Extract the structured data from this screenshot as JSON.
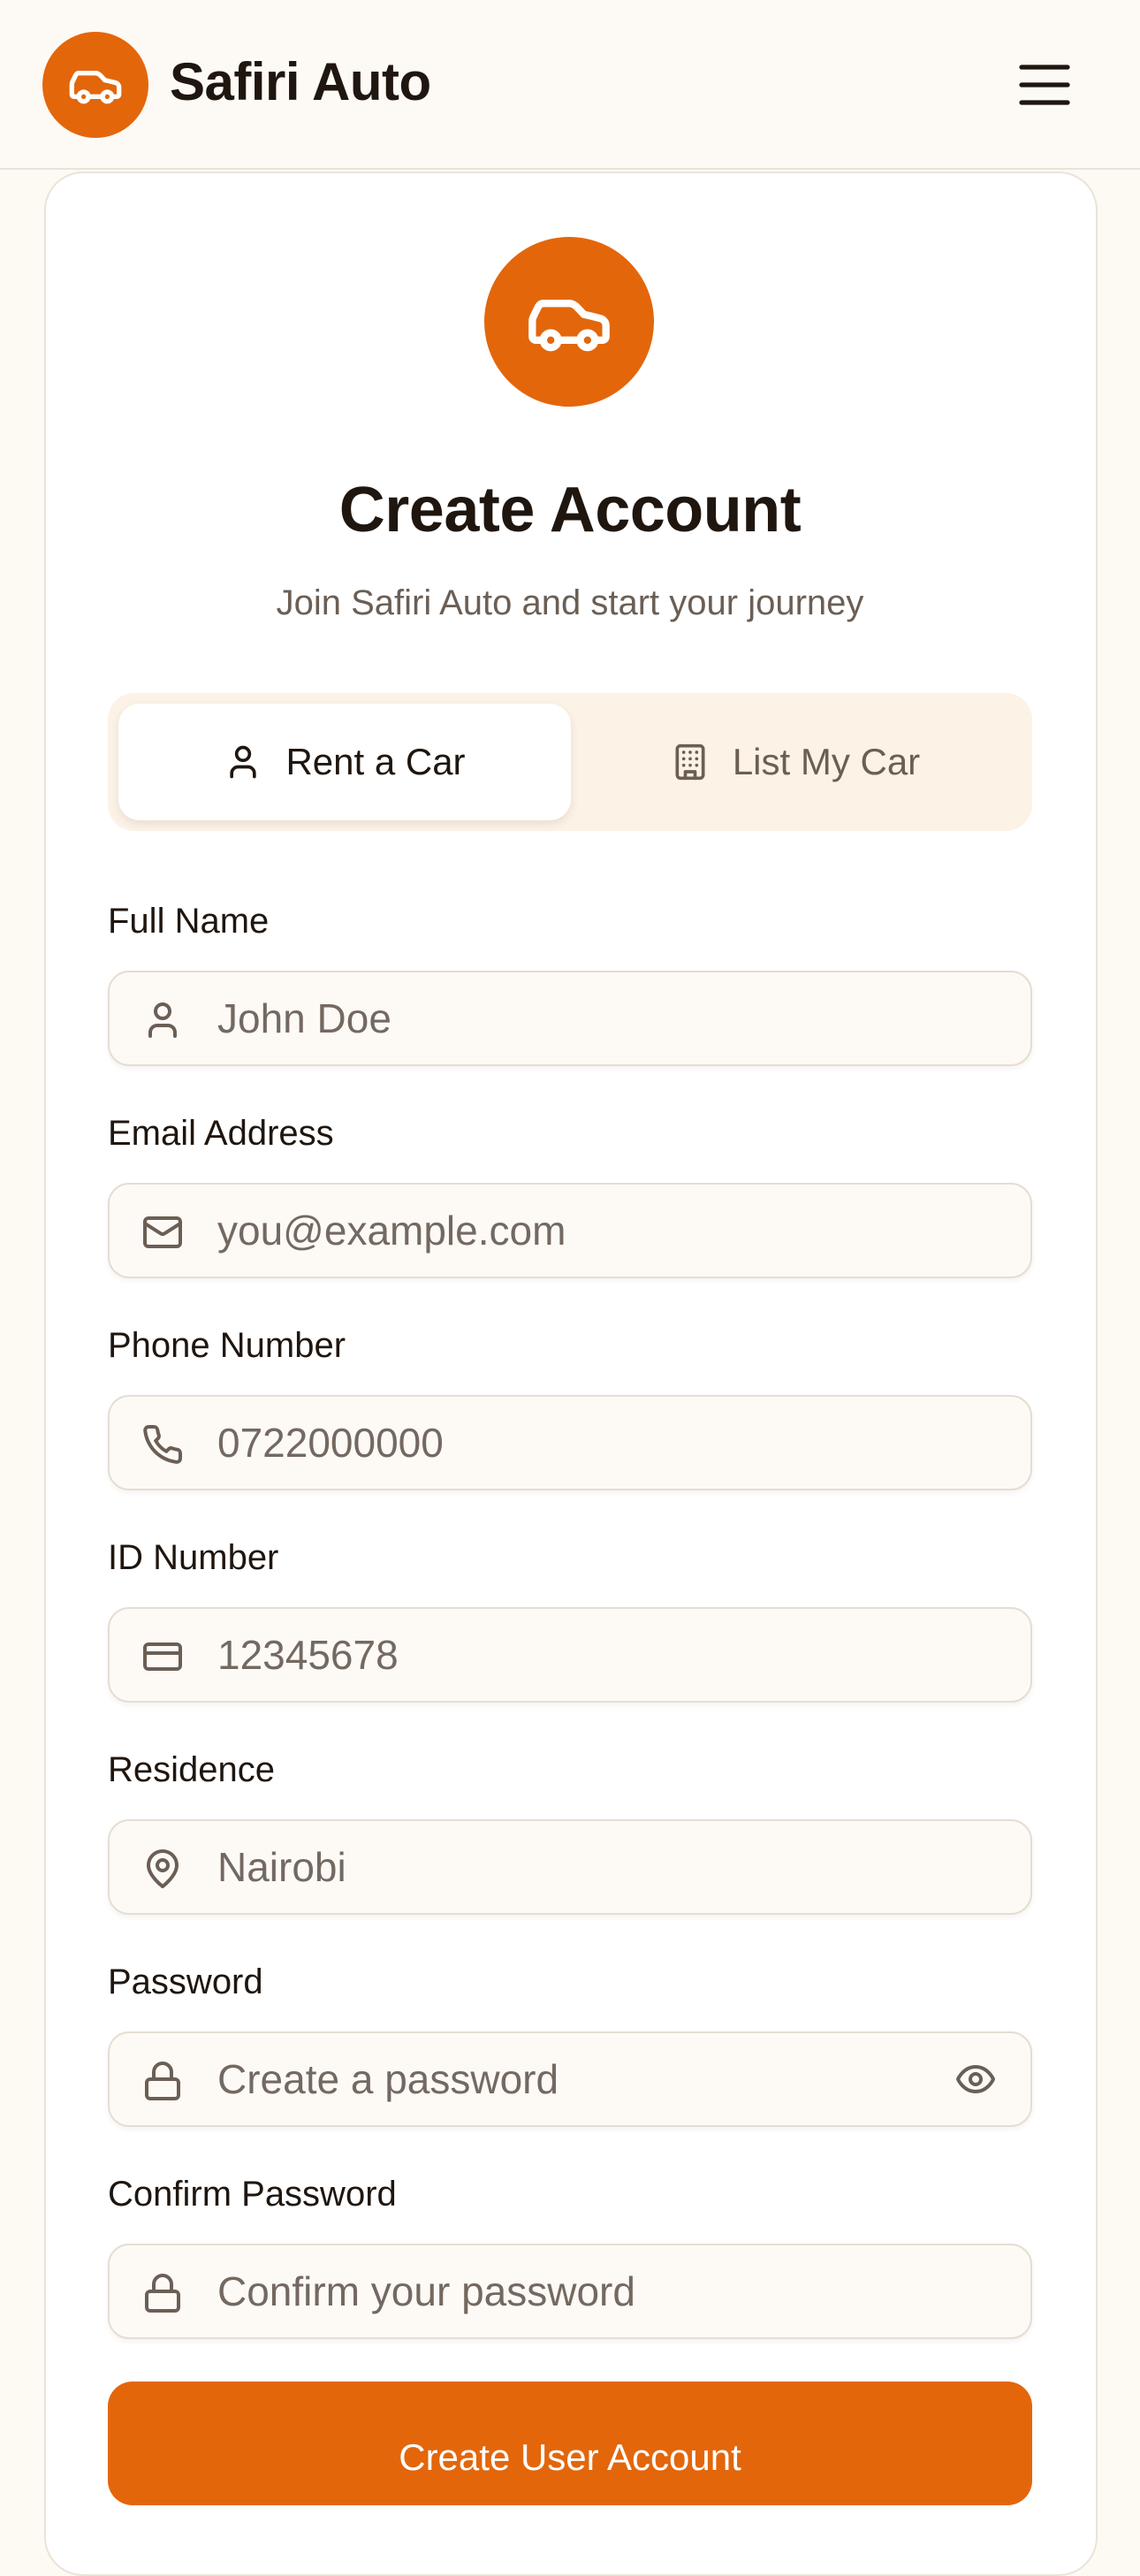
{
  "colors": {
    "accent": "#e3660b",
    "background": "#fdf9f3",
    "toggle_bg": "#fcf2e6",
    "text": "#1f160f",
    "muted": "#6b5f55"
  },
  "header": {
    "brand_name": "Safiri Auto",
    "logo_icon": "car-icon",
    "menu_icon": "hamburger-menu-icon"
  },
  "card": {
    "hero_icon": "car-icon",
    "title": "Create Account",
    "subtitle": "Join Safiri Auto and start your journey"
  },
  "account_type": {
    "options": [
      {
        "label": "Rent a Car",
        "icon": "user-icon",
        "selected": true
      },
      {
        "label": "List My Car",
        "icon": "building-icon",
        "selected": false
      }
    ]
  },
  "form": {
    "fields": [
      {
        "label": "Full Name",
        "placeholder": "John Doe",
        "value": "",
        "icon": "user-icon"
      },
      {
        "label": "Email Address",
        "placeholder": "you@example.com",
        "value": "",
        "icon": "mail-icon"
      },
      {
        "label": "Phone Number",
        "placeholder": "0722000000",
        "value": "",
        "icon": "phone-icon"
      },
      {
        "label": "ID Number",
        "placeholder": "12345678",
        "value": "",
        "icon": "id-card-icon"
      },
      {
        "label": "Residence",
        "placeholder": "Nairobi",
        "value": "",
        "icon": "map-pin-icon"
      },
      {
        "label": "Password",
        "placeholder": "Create a password",
        "value": "",
        "icon": "lock-icon",
        "toggle_icon": "eye-icon"
      },
      {
        "label": "Confirm Password",
        "placeholder": "Confirm your password",
        "value": "",
        "icon": "lock-icon"
      }
    ],
    "submit_label": "Create User Account"
  }
}
